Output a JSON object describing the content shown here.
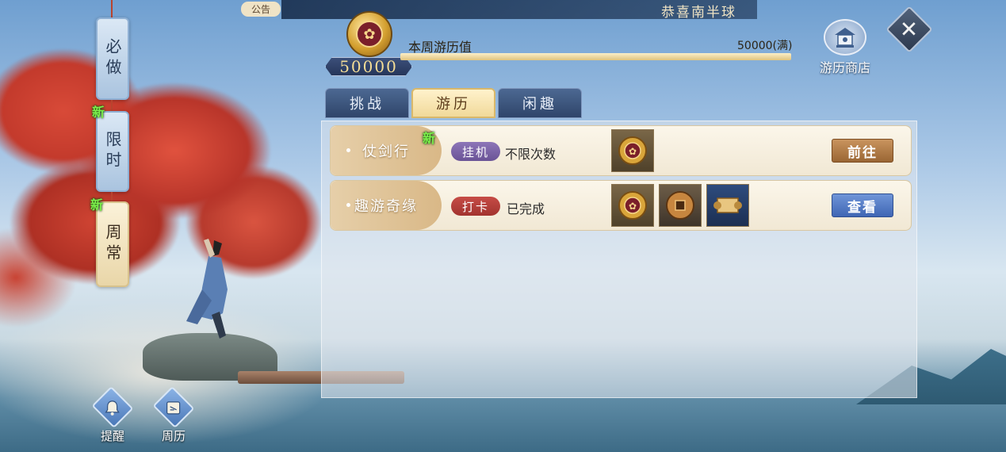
{
  "top_bar": {
    "notice_tag": "公告",
    "marquee": "恭喜南半球"
  },
  "side_tabs": [
    {
      "label": "必做",
      "active": false,
      "new": false
    },
    {
      "label": "限时",
      "active": false,
      "new": true
    },
    {
      "label": "周常",
      "active": true,
      "new": true
    }
  ],
  "new_badge": "新",
  "bottom_buttons": [
    {
      "label": "提醒",
      "icon": "bell-icon"
    },
    {
      "label": "周历",
      "icon": "calendar-icon"
    }
  ],
  "points": {
    "value": "50000",
    "title": "本周游历值",
    "cap_label": "50000(满)",
    "progress_fraction": 1.0
  },
  "shop": {
    "label": "游历商店",
    "icon": "shop-icon"
  },
  "close": {
    "icon": "close-icon"
  },
  "tabs": [
    {
      "label": "挑战",
      "active": false
    },
    {
      "label": "游历",
      "active": true
    },
    {
      "label": "闲趣",
      "active": false
    }
  ],
  "rows": [
    {
      "name": "仗剑行",
      "new": true,
      "tag": "挂机",
      "tag_color": "#7a63a8",
      "desc": "不限次数",
      "rewards": [
        "gold-coin-icon"
      ],
      "action": "前往",
      "action_color": "#b07a44"
    },
    {
      "name": "趣游奇缘",
      "new": false,
      "tag": "打卡",
      "tag_color": "#b63e39",
      "desc": "已完成",
      "rewards": [
        "gold-coin-icon",
        "copper-coin-icon",
        "scroll-icon"
      ],
      "action": "查看",
      "action_color": "#5a80c8"
    }
  ]
}
